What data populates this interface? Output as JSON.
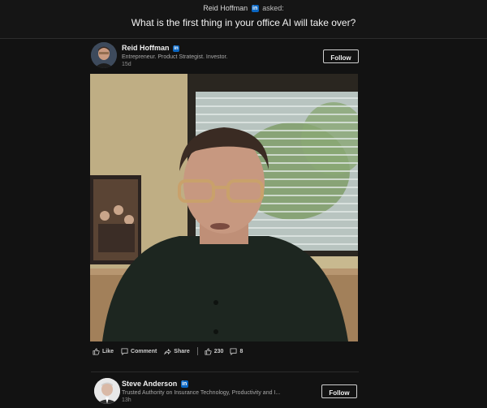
{
  "question_header": {
    "asker_name": "Reid Hoffman",
    "asked_suffix": "asked:",
    "question": "What is the first thing in your office AI will take over?"
  },
  "post": {
    "author_name": "Reid Hoffman",
    "headline": "Entrepreneur. Product Strategist. Investor.",
    "age": "15d",
    "follow_label": "Follow",
    "actions": {
      "like_label": "Like",
      "comment_label": "Comment",
      "share_label": "Share",
      "like_count": "230",
      "comment_count": "8"
    }
  },
  "next_post": {
    "author_name": "Steve Anderson",
    "headline": "Trusted Authority on Insurance Technology, Productivity and I...",
    "age": "13h",
    "follow_label": "Follow"
  },
  "icons": {
    "linkedin_badge": "linkedin-icon",
    "like": "thumbs-up-icon",
    "comment": "comment-icon",
    "share": "share-icon"
  },
  "colors": {
    "background": "#121212",
    "linkedin_blue": "#0a66c2"
  }
}
